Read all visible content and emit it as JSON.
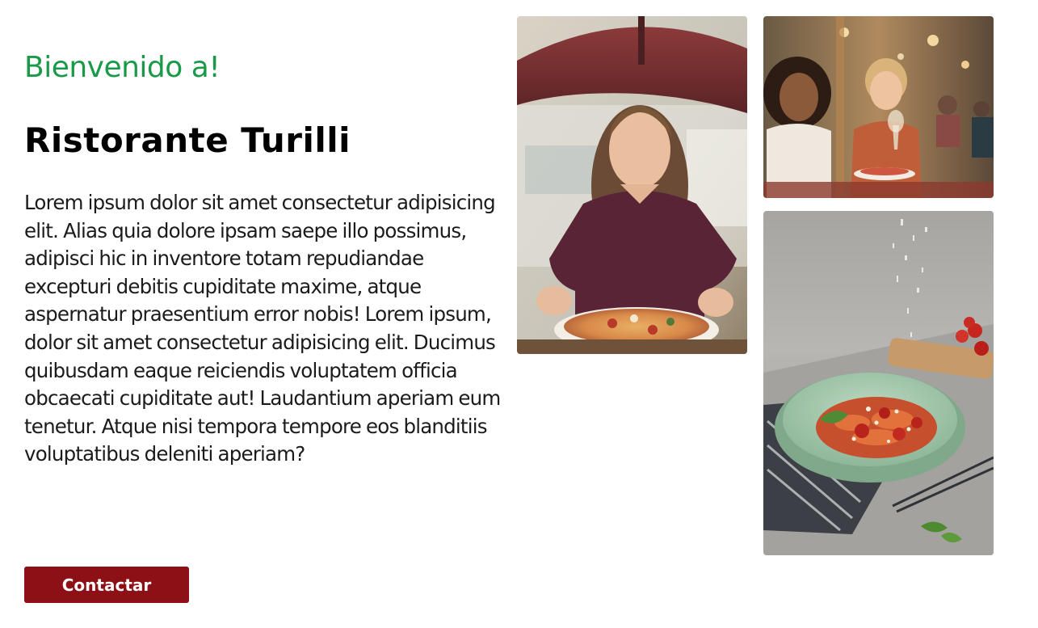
{
  "hero": {
    "welcome": "Bienvenido a!",
    "title": "Ristorante Turilli",
    "description": "Lorem ipsum dolor sit amet consectetur adipisicing elit. Alias quia dolore ipsam saepe illo possimus, adipisci hic in inventore totam repudiandae excepturi debitis cupiditate maxime, atque aspernatur praesentium error nobis! Lorem ipsum, dolor sit amet consectetur adipisicing elit. Ducimus quibusdam eaque reiciendis voluptatem officia obcaecati cupiditate aut! Laudantium aperiam eum tenetur. Atque nisi tempora tempore eos blanditiis voluptatibus deleniti aperiam?",
    "contact_label": "Contactar"
  },
  "colors": {
    "accent_green": "#1a9a48",
    "button_red": "#8c1016",
    "text": "#1b1b1b"
  },
  "gallery": {
    "images": [
      {
        "subject": "woman-with-pizza-photo"
      },
      {
        "subject": "friends-dining-photo"
      },
      {
        "subject": "pasta-dish-photo"
      }
    ]
  }
}
